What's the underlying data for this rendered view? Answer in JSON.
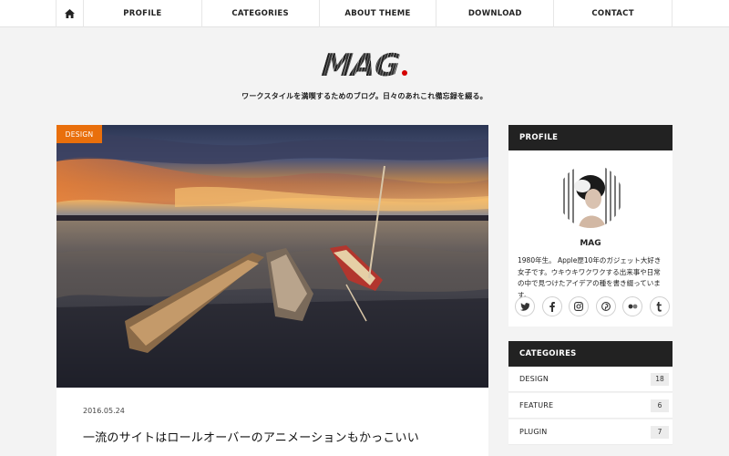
{
  "nav": {
    "home_icon": "home-icon",
    "items": [
      "PROFILE",
      "CATEGORIES",
      "ABOUT THEME",
      "DOWNLOAD",
      "CONTACT"
    ]
  },
  "site": {
    "logo": "MAG",
    "logo_dot_color": "#d40000",
    "tagline": "ワークスタイルを満喫するためのブログ。日々のあれこれ備忘録を綴る。"
  },
  "post": {
    "category": "DESIGN",
    "category_color": "#e96f0c",
    "date": "2016.05.24",
    "title": "一流のサイトはロールオーバーのアニメーションもかっこいい"
  },
  "sidebar": {
    "profile": {
      "heading": "PROFILE",
      "name": "MAG",
      "description": "1980年生。 Apple歴10年のガジェット大好き女子です。ウキウキワクワクする出来事や日常の中で見つけたアイデアの種を書き綴っています。",
      "social": [
        "twitter-icon",
        "facebook-icon",
        "instagram-icon",
        "pinterest-icon",
        "flickr-icon",
        "tumblr-icon"
      ],
      "social_glyphs": [
        "𝕥",
        "f",
        "◎",
        "℗",
        "••",
        "t"
      ]
    },
    "categories": {
      "heading": "CATEGOIRES",
      "items": [
        {
          "name": "DESIGN",
          "count": "18"
        },
        {
          "name": "FEATURE",
          "count": "6"
        },
        {
          "name": "PLUGIN",
          "count": "7"
        }
      ]
    }
  }
}
